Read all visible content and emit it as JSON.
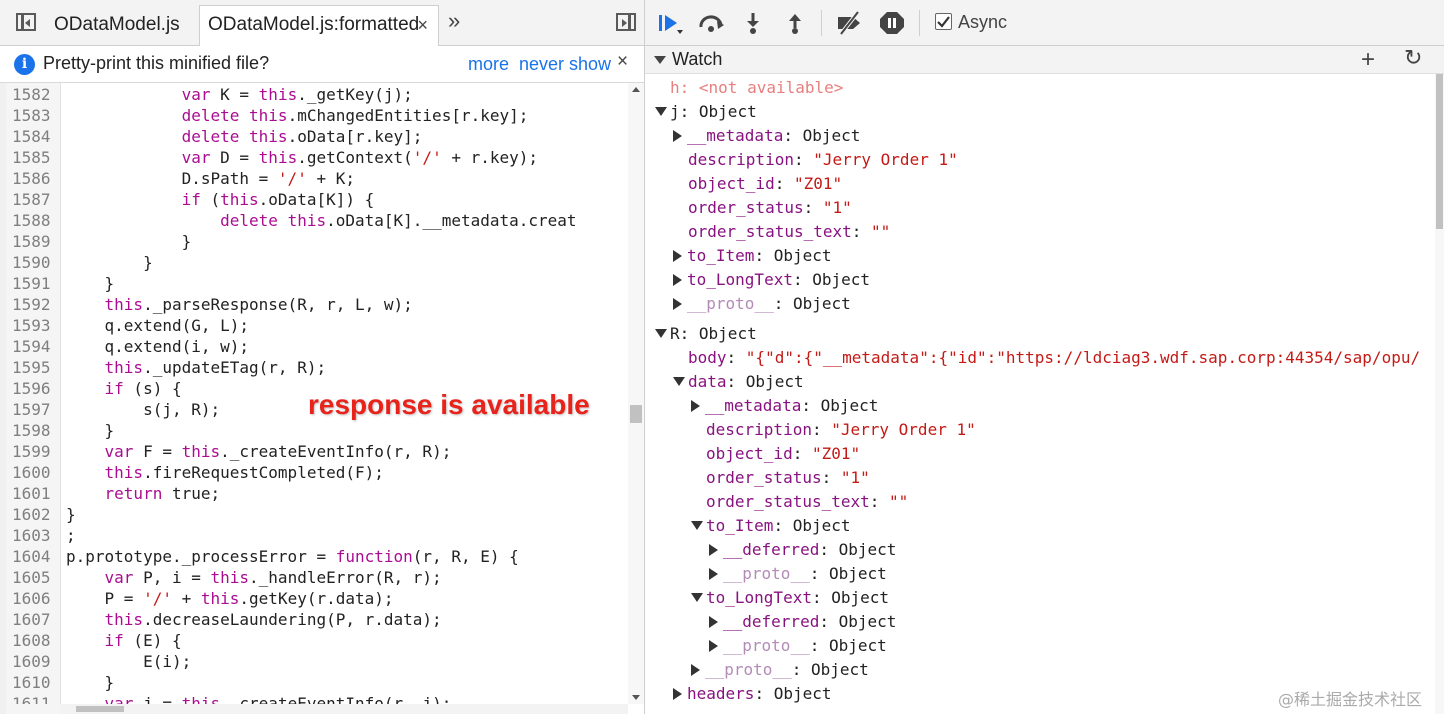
{
  "tabs": {
    "tab1": "ODataModel.js",
    "tab2": "ODataModel.js:formatted",
    "close": "×",
    "more": "»"
  },
  "infobar": {
    "text": "Pretty-print this minified file?",
    "more": "more",
    "never_show": "never show",
    "close": "×",
    "icon": "i"
  },
  "code_lines": [
    {
      "n": "1582",
      "segs": [
        [
          "",
          "            "
        ],
        [
          "kw",
          "var"
        ],
        [
          "",
          " K = "
        ],
        [
          "kw",
          "this"
        ],
        [
          "",
          "._getKey(j);"
        ]
      ]
    },
    {
      "n": "1583",
      "segs": [
        [
          "",
          "            "
        ],
        [
          "kw",
          "delete"
        ],
        [
          "",
          " "
        ],
        [
          "kw",
          "this"
        ],
        [
          "",
          ".mChangedEntities[r.key];"
        ]
      ]
    },
    {
      "n": "1584",
      "segs": [
        [
          "",
          "            "
        ],
        [
          "kw",
          "delete"
        ],
        [
          "",
          " "
        ],
        [
          "kw",
          "this"
        ],
        [
          "",
          ".oData[r.key];"
        ]
      ]
    },
    {
      "n": "1585",
      "segs": [
        [
          "",
          "            "
        ],
        [
          "kw",
          "var"
        ],
        [
          "",
          " D = "
        ],
        [
          "kw",
          "this"
        ],
        [
          "",
          ".getContext("
        ],
        [
          "str",
          "'/'"
        ],
        [
          "",
          " + r.key);"
        ]
      ]
    },
    {
      "n": "1586",
      "segs": [
        [
          "",
          "            D.sPath = "
        ],
        [
          "str",
          "'/'"
        ],
        [
          "",
          " + K;"
        ]
      ]
    },
    {
      "n": "1587",
      "segs": [
        [
          "",
          "            "
        ],
        [
          "kw",
          "if"
        ],
        [
          "",
          " ("
        ],
        [
          "kw",
          "this"
        ],
        [
          "",
          ".oData[K]) {"
        ]
      ]
    },
    {
      "n": "1588",
      "segs": [
        [
          "",
          "                "
        ],
        [
          "kw",
          "delete"
        ],
        [
          "",
          " "
        ],
        [
          "kw",
          "this"
        ],
        [
          "",
          ".oData[K].__metadata.creat"
        ]
      ]
    },
    {
      "n": "1589",
      "segs": [
        [
          "",
          "            }"
        ]
      ]
    },
    {
      "n": "1590",
      "segs": [
        [
          "",
          "        }"
        ]
      ]
    },
    {
      "n": "1591",
      "segs": [
        [
          "",
          "    }"
        ]
      ]
    },
    {
      "n": "1592",
      "segs": [
        [
          "",
          "    "
        ],
        [
          "kw",
          "this"
        ],
        [
          "",
          "._parseResponse(R, r, L, w);"
        ]
      ]
    },
    {
      "n": "1593",
      "segs": [
        [
          "",
          "    q.extend(G, L);"
        ]
      ]
    },
    {
      "n": "1594",
      "segs": [
        [
          "",
          "    q.extend(i, w);"
        ]
      ]
    },
    {
      "n": "1595",
      "segs": [
        [
          "",
          "    "
        ],
        [
          "kw",
          "this"
        ],
        [
          "",
          "._updateETag(r, R);"
        ]
      ]
    },
    {
      "n": "1596",
      "segs": [
        [
          "",
          "    "
        ],
        [
          "kw",
          "if"
        ],
        [
          "",
          " (s) {"
        ]
      ]
    },
    {
      "n": "1597",
      "segs": [
        [
          "",
          "        s(j, R);"
        ]
      ]
    },
    {
      "n": "1598",
      "segs": [
        [
          "",
          "    }"
        ]
      ]
    },
    {
      "n": "1599",
      "segs": [
        [
          "",
          "    "
        ],
        [
          "kw",
          "var"
        ],
        [
          "",
          " F = "
        ],
        [
          "kw",
          "this"
        ],
        [
          "",
          "._createEventInfo(r, R);"
        ]
      ]
    },
    {
      "n": "1600",
      "segs": [
        [
          "",
          "    "
        ],
        [
          "kw",
          "this"
        ],
        [
          "",
          ".fireRequestCompleted(F);"
        ]
      ]
    },
    {
      "n": "1601",
      "segs": [
        [
          "",
          "    "
        ],
        [
          "kw",
          "return"
        ],
        [
          "",
          " true;"
        ]
      ]
    },
    {
      "n": "1602",
      "segs": [
        [
          "",
          "}"
        ]
      ]
    },
    {
      "n": "1603",
      "segs": [
        [
          "",
          ";"
        ]
      ]
    },
    {
      "n": "1604",
      "segs": [
        [
          "",
          "p.prototype._processError = "
        ],
        [
          "kw",
          "function"
        ],
        [
          "",
          "(r, R, E) {"
        ]
      ]
    },
    {
      "n": "1605",
      "segs": [
        [
          "",
          "    "
        ],
        [
          "kw",
          "var"
        ],
        [
          "",
          " P, i = "
        ],
        [
          "kw",
          "this"
        ],
        [
          "",
          "._handleError(R, r);"
        ]
      ]
    },
    {
      "n": "1606",
      "segs": [
        [
          "",
          "    P = "
        ],
        [
          "str",
          "'/'"
        ],
        [
          "",
          " + "
        ],
        [
          "kw",
          "this"
        ],
        [
          "",
          ".getKey(r.data);"
        ]
      ]
    },
    {
      "n": "1607",
      "segs": [
        [
          "",
          "    "
        ],
        [
          "kw",
          "this"
        ],
        [
          "",
          ".decreaseLaundering(P, r.data);"
        ]
      ]
    },
    {
      "n": "1608",
      "segs": [
        [
          "",
          "    "
        ],
        [
          "kw",
          "if"
        ],
        [
          "",
          " (E) {"
        ]
      ]
    },
    {
      "n": "1609",
      "segs": [
        [
          "",
          "        E(i);"
        ]
      ]
    },
    {
      "n": "1610",
      "segs": [
        [
          "",
          "    }"
        ]
      ]
    },
    {
      "n": "1611",
      "segs": [
        [
          "",
          "    "
        ],
        [
          "kw",
          "var"
        ],
        [
          "",
          " j = "
        ],
        [
          "kw",
          "this"
        ],
        [
          "",
          "._createEventInfo(r, j);"
        ]
      ]
    }
  ],
  "annotation": "response is available",
  "toolbar": {
    "async_label": "Async",
    "async_checked": true
  },
  "watch": {
    "title": "Watch",
    "add": "+",
    "refresh": "↻"
  },
  "tree": [
    {
      "indent": 0,
      "tri": "none",
      "key": "h",
      "ktype": "h",
      "sep": ": ",
      "val": "<not available>",
      "vtype": "na"
    },
    {
      "indent": 0,
      "tri": "down",
      "key": "j",
      "ktype": "t",
      "sep": ": ",
      "val": "Object",
      "vtype": "v"
    },
    {
      "indent": 1,
      "tri": "right",
      "key": "__metadata",
      "ktype": "k",
      "sep": ": ",
      "val": "Object",
      "vtype": "v"
    },
    {
      "indent": 1,
      "tri": "none",
      "key": "description",
      "ktype": "k",
      "sep": ": ",
      "val": "\"Jerry Order 1\"",
      "vtype": "vs"
    },
    {
      "indent": 1,
      "tri": "none",
      "key": "object_id",
      "ktype": "k",
      "sep": ": ",
      "val": "\"Z01\"",
      "vtype": "vs"
    },
    {
      "indent": 1,
      "tri": "none",
      "key": "order_status",
      "ktype": "k",
      "sep": ": ",
      "val": "\"1\"",
      "vtype": "vs"
    },
    {
      "indent": 1,
      "tri": "none",
      "key": "order_status_text",
      "ktype": "k",
      "sep": ": ",
      "val": "\"\"",
      "vtype": "vs"
    },
    {
      "indent": 1,
      "tri": "right",
      "key": "to_Item",
      "ktype": "k",
      "sep": ": ",
      "val": "Object",
      "vtype": "v"
    },
    {
      "indent": 1,
      "tri": "right",
      "key": "to_LongText",
      "ktype": "k",
      "sep": ": ",
      "val": "Object",
      "vtype": "v"
    },
    {
      "indent": 1,
      "tri": "right",
      "key": "__proto__",
      "ktype": "kp",
      "sep": ": ",
      "val": "Object",
      "vtype": "v"
    },
    {
      "indent": 0,
      "tri": "down",
      "key": "R",
      "ktype": "t",
      "sep": ": ",
      "val": "Object",
      "vtype": "v"
    },
    {
      "indent": 1,
      "tri": "none",
      "key": "body",
      "ktype": "k",
      "sep": ": ",
      "val": "\"{\"d\":{\"__metadata\":{\"id\":\"https://ldciag3.wdf.sap.corp:44354/sap/opu/",
      "vtype": "vs"
    },
    {
      "indent": 1,
      "tri": "down",
      "key": "data",
      "ktype": "k",
      "sep": ": ",
      "val": "Object",
      "vtype": "v"
    },
    {
      "indent": 2,
      "tri": "right",
      "key": "__metadata",
      "ktype": "k",
      "sep": ": ",
      "val": "Object",
      "vtype": "v"
    },
    {
      "indent": 2,
      "tri": "none",
      "key": "description",
      "ktype": "k",
      "sep": ": ",
      "val": "\"Jerry Order 1\"",
      "vtype": "vs"
    },
    {
      "indent": 2,
      "tri": "none",
      "key": "object_id",
      "ktype": "k",
      "sep": ": ",
      "val": "\"Z01\"",
      "vtype": "vs"
    },
    {
      "indent": 2,
      "tri": "none",
      "key": "order_status",
      "ktype": "k",
      "sep": ": ",
      "val": "\"1\"",
      "vtype": "vs"
    },
    {
      "indent": 2,
      "tri": "none",
      "key": "order_status_text",
      "ktype": "k",
      "sep": ": ",
      "val": "\"\"",
      "vtype": "vs"
    },
    {
      "indent": 2,
      "tri": "down",
      "key": "to_Item",
      "ktype": "k",
      "sep": ": ",
      "val": "Object",
      "vtype": "v"
    },
    {
      "indent": 3,
      "tri": "right",
      "key": "__deferred",
      "ktype": "k",
      "sep": ": ",
      "val": "Object",
      "vtype": "v"
    },
    {
      "indent": 3,
      "tri": "right",
      "key": "__proto__",
      "ktype": "kp",
      "sep": ": ",
      "val": "Object",
      "vtype": "v"
    },
    {
      "indent": 2,
      "tri": "down",
      "key": "to_LongText",
      "ktype": "k",
      "sep": ": ",
      "val": "Object",
      "vtype": "v"
    },
    {
      "indent": 3,
      "tri": "right",
      "key": "__deferred",
      "ktype": "k",
      "sep": ": ",
      "val": "Object",
      "vtype": "v"
    },
    {
      "indent": 3,
      "tri": "right",
      "key": "__proto__",
      "ktype": "kp",
      "sep": ": ",
      "val": "Object",
      "vtype": "v"
    },
    {
      "indent": 2,
      "tri": "right",
      "key": "__proto__",
      "ktype": "kp",
      "sep": ": ",
      "val": "Object",
      "vtype": "v"
    },
    {
      "indent": 1,
      "tri": "right",
      "key": "headers",
      "ktype": "k",
      "sep": ": ",
      "val": "Object",
      "vtype": "v"
    }
  ],
  "watermark": "@稀土掘金技术社区",
  "icons": [
    "toggle-navigator-icon",
    "resume-icon",
    "step-over-icon",
    "step-into-icon",
    "step-out-icon",
    "deactivate-breakpoints-icon",
    "pause-on-exceptions-icon",
    "toggle-debugger-icon",
    "more-tabs-icon",
    "info-icon",
    "close-icon",
    "add-icon",
    "refresh-icon"
  ],
  "colors": {
    "keyword": "#aa0d91",
    "string": "#c41a16",
    "annotation": "#e8231b",
    "link": "#1a73e8",
    "accent": "#1a73e8"
  }
}
